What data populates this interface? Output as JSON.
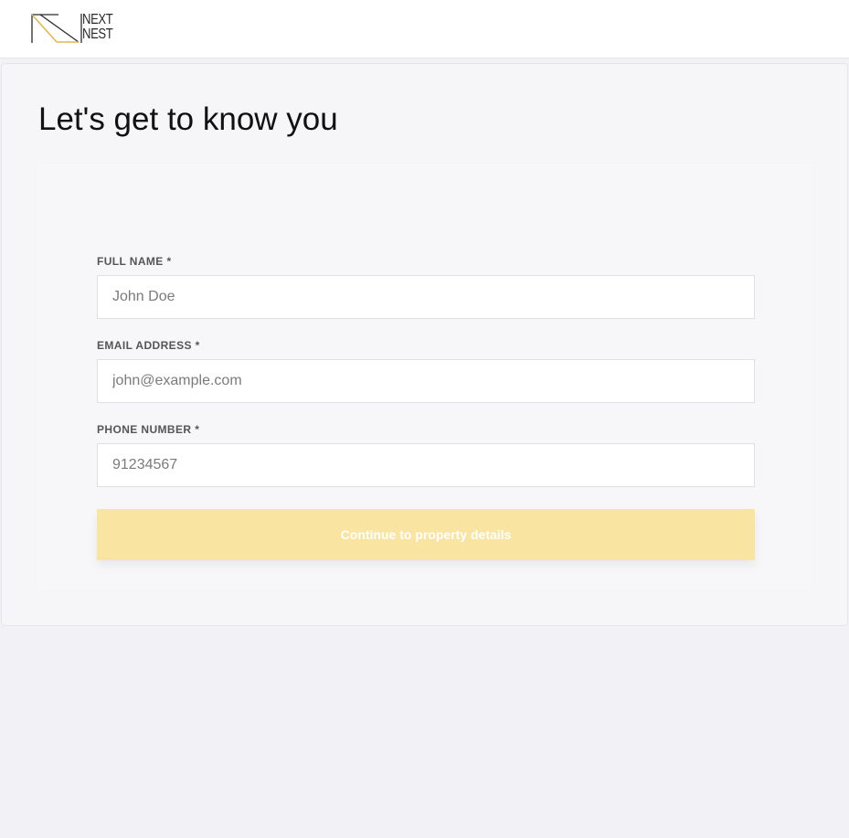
{
  "header": {
    "logo_line1": "NEXT",
    "logo_line2": "NEST",
    "accent_color": "#e2b84c"
  },
  "page": {
    "title": "Let's get to know you"
  },
  "form": {
    "full_name": {
      "label": "FULL NAME *",
      "placeholder": "John Doe",
      "value": ""
    },
    "email": {
      "label": "EMAIL ADDRESS *",
      "placeholder": "john@example.com",
      "value": ""
    },
    "phone": {
      "label": "PHONE NUMBER *",
      "placeholder": "91234567",
      "value": ""
    },
    "submit_label": "Continue to property details",
    "submit_color": "#f9e4a2"
  }
}
